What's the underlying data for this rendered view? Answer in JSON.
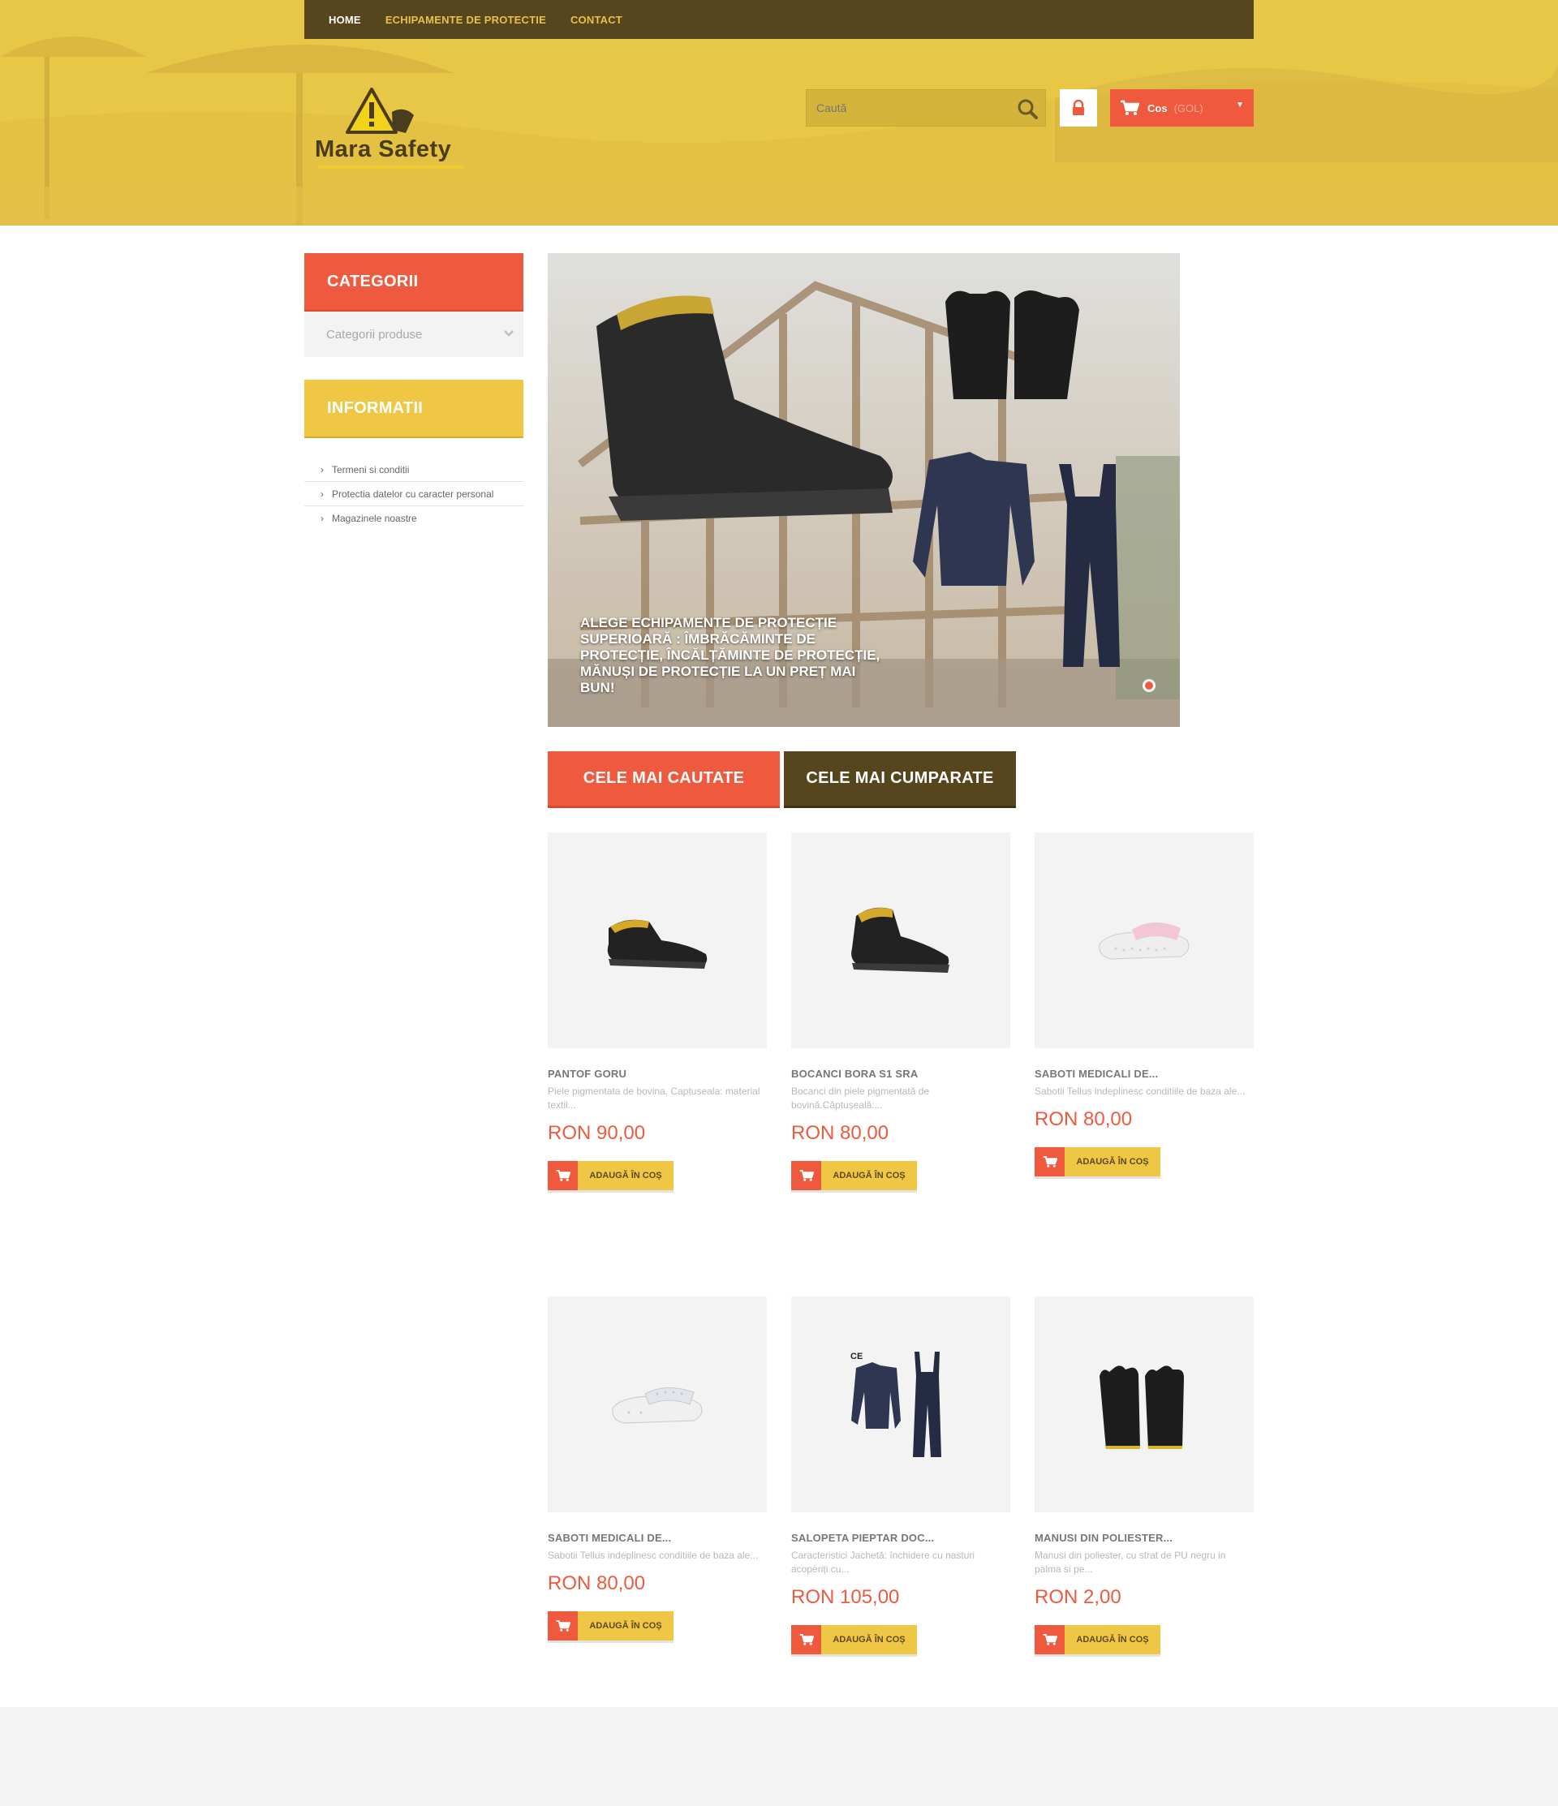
{
  "nav": {
    "items": [
      {
        "label": "HOME",
        "active": true
      },
      {
        "label": "ECHIPAMENTE DE PROTECTIE",
        "active": false
      },
      {
        "label": "CONTACT",
        "active": false
      }
    ]
  },
  "logo": {
    "text": "Mara Safety"
  },
  "search": {
    "placeholder": "Caută"
  },
  "cart": {
    "label": "Cos",
    "status": "(GOL)"
  },
  "sidebar": {
    "categories_title": "CATEGORII",
    "categories_select": "Categorii produse",
    "info_title": "INFORMATII",
    "info_items": [
      {
        "label": "Termeni si conditii"
      },
      {
        "label": "Protectia datelor cu caracter personal"
      },
      {
        "label": "Magazinele noastre"
      }
    ]
  },
  "slider": {
    "caption": "ALEGE ECHIPAMENTE DE PROTECȚIE SUPERIOARĂ : ÎMBRĂCĂMINTE DE PROTECȚIE, ÎNCĂLȚĂMINTE DE PROTECȚIE, MĂNUȘI DE PROTECȚIE LA UN PREȚ MAI BUN!"
  },
  "tabs": [
    {
      "label": "CELE MAI CAUTATE"
    },
    {
      "label": "CELE MAI CUMPARATE"
    }
  ],
  "products": [
    {
      "name": "PANTOF GORU",
      "desc": "Piele pigmentata de bovina. Captuseala: material textil...",
      "price": "RON 90,00",
      "button": "ADAUGĂ ÎN COȘ",
      "image": "black-shoe-icon"
    },
    {
      "name": "BOCANCI BORA S1 SRA",
      "desc": "Bocanci din piele pigmentată de bovină.Căptușeală:...",
      "price": "RON 80,00",
      "button": "ADAUGĂ ÎN COȘ",
      "image": "black-boot-icon"
    },
    {
      "name": "SABOTI MEDICALI DE...",
      "desc": "Sabotii Tellus indeplinesc conditiile de baza ale...",
      "price": "RON 80,00",
      "button": "ADAUGĂ ÎN COȘ",
      "image": "pink-clog-icon"
    },
    {
      "name": "SABOTI MEDICALI DE...",
      "desc": "Sabotii Tellus indeplinesc conditiile de baza ale...",
      "price": "RON 80,00",
      "button": "ADAUGĂ ÎN COȘ",
      "image": "white-clog-icon"
    },
    {
      "name": "SALOPETA PIEPTAR DOC...",
      "desc": "Caracteristici Jachetă: închidere cu nasturi acoperiți cu...",
      "price": "RON 105,00",
      "button": "ADAUGĂ ÎN COȘ",
      "image": "workwear-icon"
    },
    {
      "name": "MANUSI DIN POLIESTER...",
      "desc": "Manusi din poliester, cu strat de PU negru in palma si pe...",
      "price": "RON 2,00",
      "button": "ADAUGĂ ÎN COȘ",
      "image": "gloves-icon"
    }
  ],
  "colors": {
    "accent": "#ef5a3e",
    "yellow": "#f0c745",
    "brown": "#56451d"
  }
}
